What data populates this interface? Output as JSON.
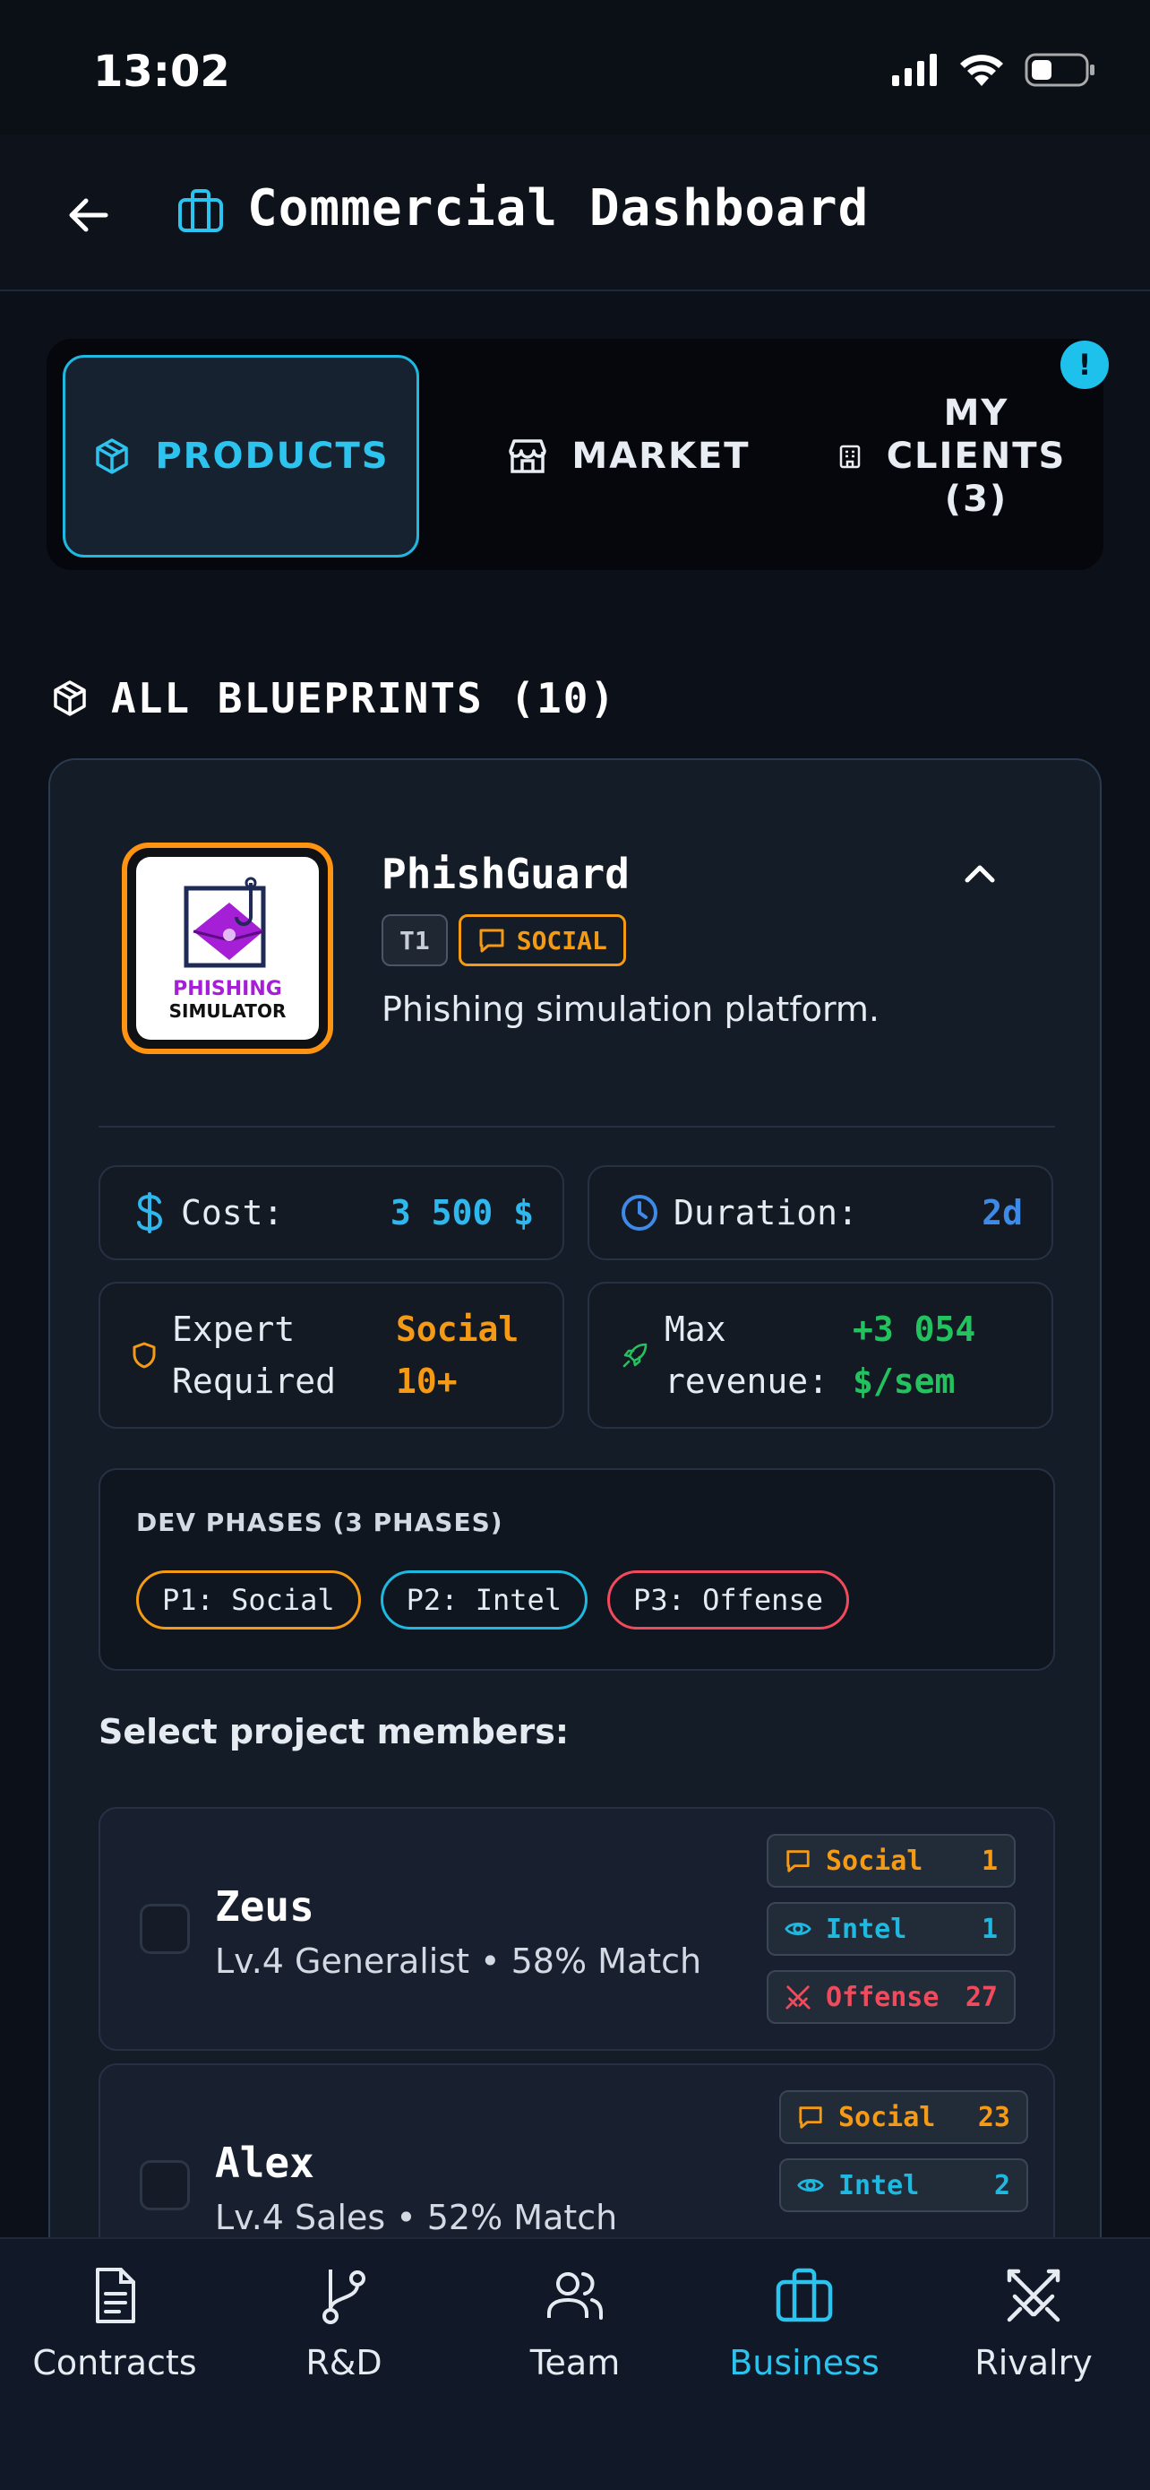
{
  "status": {
    "time": "13:02"
  },
  "header": {
    "title": "Commercial Dashboard"
  },
  "tabs": {
    "products": "PRODUCTS",
    "market": "MARKET",
    "clients_line1": "MY",
    "clients_line2": "CLIENTS",
    "clients_line3": "(3)",
    "alert": "!"
  },
  "section": {
    "title": "ALL BLUEPRINTS (10)"
  },
  "blueprint": {
    "name": "PhishGuard",
    "tier": "T1",
    "category": "SOCIAL",
    "description": "Phishing simulation platform.",
    "thumb_line1": "PHISHING",
    "thumb_line2": "SIMULATOR",
    "cost_label": "Cost:",
    "cost_value": "3 500 $",
    "duration_label": "Duration:",
    "duration_value": "2d",
    "expert_label_1": "Expert",
    "expert_label_2": "Required",
    "expert_value_1": "Social",
    "expert_value_2": "10+",
    "revenue_label_1": "Max",
    "revenue_label_2": "revenue:",
    "revenue_value_1": "+3 054",
    "revenue_value_2": "$/sem",
    "phases_title": "DEV PHASES (3 PHASES)",
    "phases": [
      "P1: Social",
      "P2: Intel",
      "P3: Offense"
    ],
    "select_title": "Select project members:"
  },
  "members": [
    {
      "name": "Zeus",
      "subtitle": "Lv.4 Generalist • 58% Match",
      "skills": [
        {
          "name": "Social",
          "value": "1"
        },
        {
          "name": "Intel",
          "value": "1"
        },
        {
          "name": "Offense",
          "value": "27"
        }
      ]
    },
    {
      "name": "Alex",
      "subtitle": "Lv.4 Sales • 52% Match",
      "skills": [
        {
          "name": "Social",
          "value": "23"
        },
        {
          "name": "Intel",
          "value": "2"
        }
      ]
    }
  ],
  "nav": {
    "contracts": "Contracts",
    "rnd": "R&D",
    "team": "Team",
    "business": "Business",
    "rivalry": "Rivalry"
  },
  "colors": {
    "accent": "#2cc4ee",
    "social": "#f59a14",
    "intel": "#1fb8e0",
    "offense": "#f04b5c",
    "revenue": "#22c35e"
  }
}
